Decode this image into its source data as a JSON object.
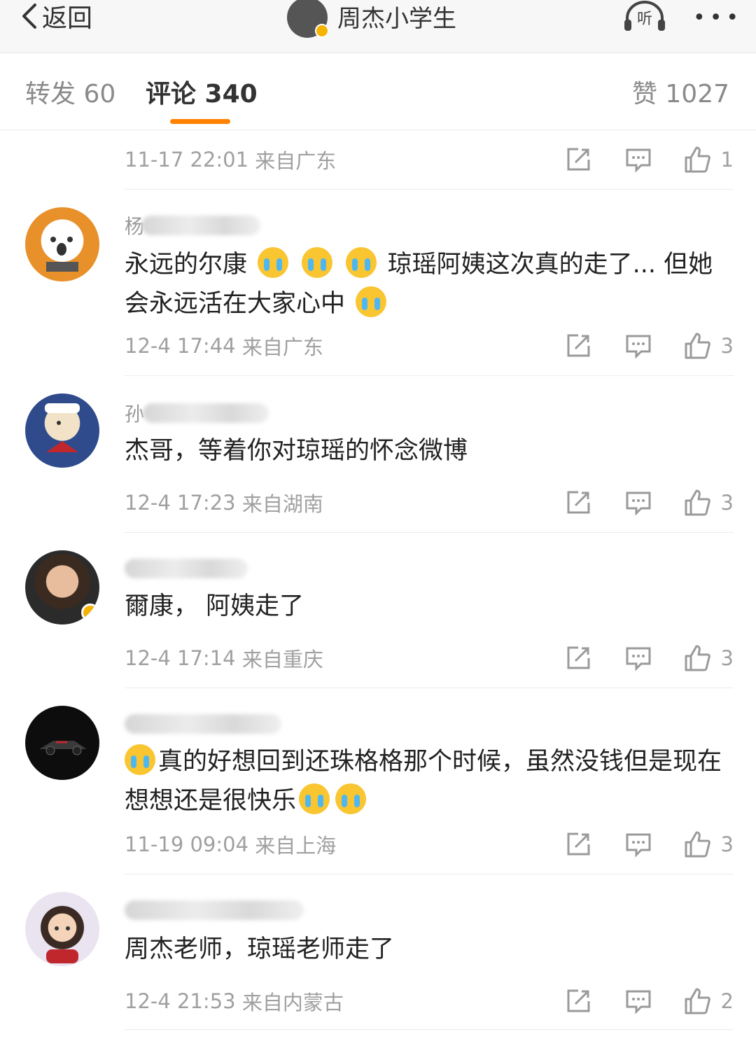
{
  "header": {
    "back_label": "返回",
    "account_name": "周杰小学生",
    "listen_label": "听",
    "more_label": "•••"
  },
  "tabs": [
    {
      "label": "转发 60"
    },
    {
      "label": "评论 340"
    },
    {
      "label": "赞 1027"
    }
  ],
  "accent_color": "#ff8200",
  "first_meta": {
    "time": "11-17 22:01",
    "location": "来自广东",
    "likes": "1"
  },
  "comments": [
    {
      "username": "杨",
      "text_before": "永远的尔康",
      "text_after": "琼瑶阿姨这次真的走了... 但她会永远活在大家心中",
      "time": "12-4 17:44",
      "location": "来自广东",
      "likes": "3"
    },
    {
      "username": "孙",
      "text": "杰哥，等着你对琼瑶的怀念微博",
      "time": "12-4 17:23",
      "location": "来自湖南",
      "likes": "3"
    },
    {
      "username": "",
      "text": "爾康， 阿姨走了",
      "time": "12-4 17:14",
      "location": "来自重庆",
      "likes": "3"
    },
    {
      "username": "",
      "text": "真的好想回到还珠格格那个时候，虽然没钱但是现在想想还是很快乐",
      "time": "11-19 09:04",
      "location": "来自上海",
      "likes": "3"
    },
    {
      "username": "",
      "text": "周杰老师，琼瑶老师走了",
      "time": "12-4 21:53",
      "location": "来自内蒙古",
      "likes": "2"
    }
  ]
}
